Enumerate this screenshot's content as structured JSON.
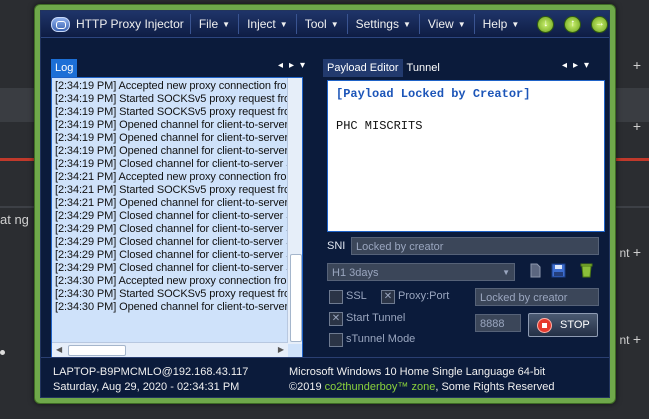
{
  "background": {
    "left_text": "at ng",
    "right_text_1": "nt",
    "right_text_2": "nt"
  },
  "titlebar": {
    "title": "HTTP Proxy Injector",
    "menu": [
      "File",
      "Inject",
      "Tool",
      "Settings",
      "View",
      "Help"
    ]
  },
  "log_panel": {
    "tab": "Log",
    "lines": [
      "[2:34:19 PM] Accepted new proxy connection fro",
      "[2:34:19 PM] Started SOCKSv5 proxy request fro",
      "[2:34:19 PM] Started SOCKSv5 proxy request fro",
      "[2:34:19 PM] Opened channel for client-to-server",
      "[2:34:19 PM] Opened channel for client-to-server",
      "[2:34:19 PM] Opened channel for client-to-server",
      "[2:34:19 PM] Closed channel for client-to-server S",
      "[2:34:21 PM] Accepted new proxy connection fro",
      "[2:34:21 PM] Started SOCKSv5 proxy request fro",
      "[2:34:21 PM] Opened channel for client-to-server",
      "[2:34:29 PM] Closed channel for client-to-server S",
      "[2:34:29 PM] Closed channel for client-to-server S",
      "[2:34:29 PM] Closed channel for client-to-server S",
      "[2:34:29 PM] Closed channel for client-to-server S",
      "[2:34:29 PM] Closed channel for client-to-server S",
      "[2:34:30 PM] Accepted new proxy connection fro",
      "[2:34:30 PM] Started SOCKSv5 proxy request fro",
      "[2:34:30 PM] Opened channel for client-to-server"
    ]
  },
  "payload_panel": {
    "tab_payload": "Payload Editor",
    "tab_tunnel": "Tunnel",
    "line1": "[Payload Locked by Creator]",
    "line2": "PHC MISCRITS"
  },
  "sni": {
    "label": "SNI",
    "value": "Locked by creator"
  },
  "payload_select": {
    "value": "H1 3days"
  },
  "options": {
    "ssl_label": "SSL",
    "ssl_checked": false,
    "proxy_port_label": "Proxy:Port",
    "proxy_port_checked": true,
    "proxy_value": "Locked by creator",
    "start_tunnel_label": "Start Tunnel",
    "start_tunnel_checked": true,
    "stunnel_label": "sTunnel Mode",
    "stunnel_checked": false,
    "port_value": "8888",
    "stop_label": "STOP"
  },
  "status": {
    "host": "LAPTOP-B9PMCMLO@192.168.43.117",
    "datetime": "Saturday, Aug 29, 2020 - 02:34:31 PM",
    "os": "Microsoft Windows 10 Home Single Language 64-bit",
    "copyright_prefix": "©2019",
    "copyright_brand": "co2thunderboy™ zone",
    "copyright_suffix": ", Some Rights Reserved"
  },
  "colors": {
    "window_frame": "#6fa84a",
    "window_bg": "#0b1b3b",
    "log_bg": "#cfe2fa",
    "accent": "#1c6fd6",
    "payload_locked_text": "#1c55b8",
    "brand_green": "#8ad23c",
    "stop_icon": "#e63a2e"
  },
  "icons": [
    "app-logo-icon",
    "download-icon",
    "upload-icon",
    "forward-icon",
    "new-file-icon",
    "save-icon",
    "recycle-bin-icon",
    "stop-icon"
  ]
}
